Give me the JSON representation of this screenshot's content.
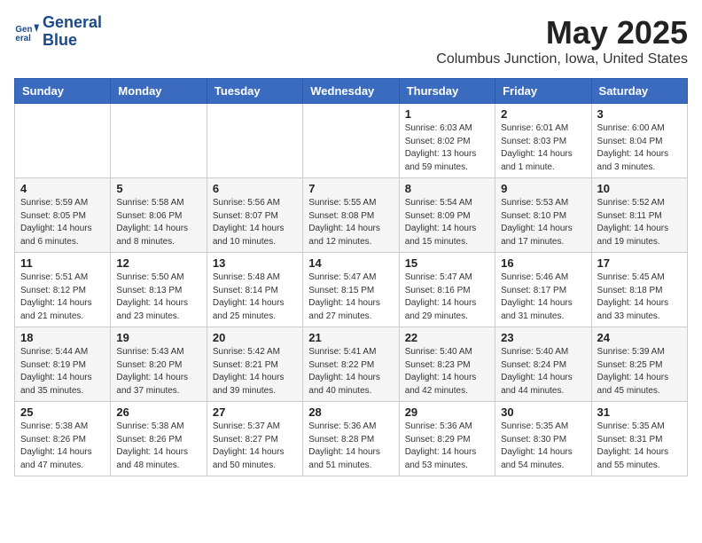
{
  "logo": {
    "line1": "General",
    "line2": "Blue"
  },
  "title": "May 2025",
  "subtitle": "Columbus Junction, Iowa, United States",
  "days_header": [
    "Sunday",
    "Monday",
    "Tuesday",
    "Wednesday",
    "Thursday",
    "Friday",
    "Saturday"
  ],
  "weeks": [
    [
      {
        "day": "",
        "info": ""
      },
      {
        "day": "",
        "info": ""
      },
      {
        "day": "",
        "info": ""
      },
      {
        "day": "",
        "info": ""
      },
      {
        "day": "1",
        "info": "Sunrise: 6:03 AM\nSunset: 8:02 PM\nDaylight: 13 hours\nand 59 minutes."
      },
      {
        "day": "2",
        "info": "Sunrise: 6:01 AM\nSunset: 8:03 PM\nDaylight: 14 hours\nand 1 minute."
      },
      {
        "day": "3",
        "info": "Sunrise: 6:00 AM\nSunset: 8:04 PM\nDaylight: 14 hours\nand 3 minutes."
      }
    ],
    [
      {
        "day": "4",
        "info": "Sunrise: 5:59 AM\nSunset: 8:05 PM\nDaylight: 14 hours\nand 6 minutes."
      },
      {
        "day": "5",
        "info": "Sunrise: 5:58 AM\nSunset: 8:06 PM\nDaylight: 14 hours\nand 8 minutes."
      },
      {
        "day": "6",
        "info": "Sunrise: 5:56 AM\nSunset: 8:07 PM\nDaylight: 14 hours\nand 10 minutes."
      },
      {
        "day": "7",
        "info": "Sunrise: 5:55 AM\nSunset: 8:08 PM\nDaylight: 14 hours\nand 12 minutes."
      },
      {
        "day": "8",
        "info": "Sunrise: 5:54 AM\nSunset: 8:09 PM\nDaylight: 14 hours\nand 15 minutes."
      },
      {
        "day": "9",
        "info": "Sunrise: 5:53 AM\nSunset: 8:10 PM\nDaylight: 14 hours\nand 17 minutes."
      },
      {
        "day": "10",
        "info": "Sunrise: 5:52 AM\nSunset: 8:11 PM\nDaylight: 14 hours\nand 19 minutes."
      }
    ],
    [
      {
        "day": "11",
        "info": "Sunrise: 5:51 AM\nSunset: 8:12 PM\nDaylight: 14 hours\nand 21 minutes."
      },
      {
        "day": "12",
        "info": "Sunrise: 5:50 AM\nSunset: 8:13 PM\nDaylight: 14 hours\nand 23 minutes."
      },
      {
        "day": "13",
        "info": "Sunrise: 5:48 AM\nSunset: 8:14 PM\nDaylight: 14 hours\nand 25 minutes."
      },
      {
        "day": "14",
        "info": "Sunrise: 5:47 AM\nSunset: 8:15 PM\nDaylight: 14 hours\nand 27 minutes."
      },
      {
        "day": "15",
        "info": "Sunrise: 5:47 AM\nSunset: 8:16 PM\nDaylight: 14 hours\nand 29 minutes."
      },
      {
        "day": "16",
        "info": "Sunrise: 5:46 AM\nSunset: 8:17 PM\nDaylight: 14 hours\nand 31 minutes."
      },
      {
        "day": "17",
        "info": "Sunrise: 5:45 AM\nSunset: 8:18 PM\nDaylight: 14 hours\nand 33 minutes."
      }
    ],
    [
      {
        "day": "18",
        "info": "Sunrise: 5:44 AM\nSunset: 8:19 PM\nDaylight: 14 hours\nand 35 minutes."
      },
      {
        "day": "19",
        "info": "Sunrise: 5:43 AM\nSunset: 8:20 PM\nDaylight: 14 hours\nand 37 minutes."
      },
      {
        "day": "20",
        "info": "Sunrise: 5:42 AM\nSunset: 8:21 PM\nDaylight: 14 hours\nand 39 minutes."
      },
      {
        "day": "21",
        "info": "Sunrise: 5:41 AM\nSunset: 8:22 PM\nDaylight: 14 hours\nand 40 minutes."
      },
      {
        "day": "22",
        "info": "Sunrise: 5:40 AM\nSunset: 8:23 PM\nDaylight: 14 hours\nand 42 minutes."
      },
      {
        "day": "23",
        "info": "Sunrise: 5:40 AM\nSunset: 8:24 PM\nDaylight: 14 hours\nand 44 minutes."
      },
      {
        "day": "24",
        "info": "Sunrise: 5:39 AM\nSunset: 8:25 PM\nDaylight: 14 hours\nand 45 minutes."
      }
    ],
    [
      {
        "day": "25",
        "info": "Sunrise: 5:38 AM\nSunset: 8:26 PM\nDaylight: 14 hours\nand 47 minutes."
      },
      {
        "day": "26",
        "info": "Sunrise: 5:38 AM\nSunset: 8:26 PM\nDaylight: 14 hours\nand 48 minutes."
      },
      {
        "day": "27",
        "info": "Sunrise: 5:37 AM\nSunset: 8:27 PM\nDaylight: 14 hours\nand 50 minutes."
      },
      {
        "day": "28",
        "info": "Sunrise: 5:36 AM\nSunset: 8:28 PM\nDaylight: 14 hours\nand 51 minutes."
      },
      {
        "day": "29",
        "info": "Sunrise: 5:36 AM\nSunset: 8:29 PM\nDaylight: 14 hours\nand 53 minutes."
      },
      {
        "day": "30",
        "info": "Sunrise: 5:35 AM\nSunset: 8:30 PM\nDaylight: 14 hours\nand 54 minutes."
      },
      {
        "day": "31",
        "info": "Sunrise: 5:35 AM\nSunset: 8:31 PM\nDaylight: 14 hours\nand 55 minutes."
      }
    ]
  ]
}
